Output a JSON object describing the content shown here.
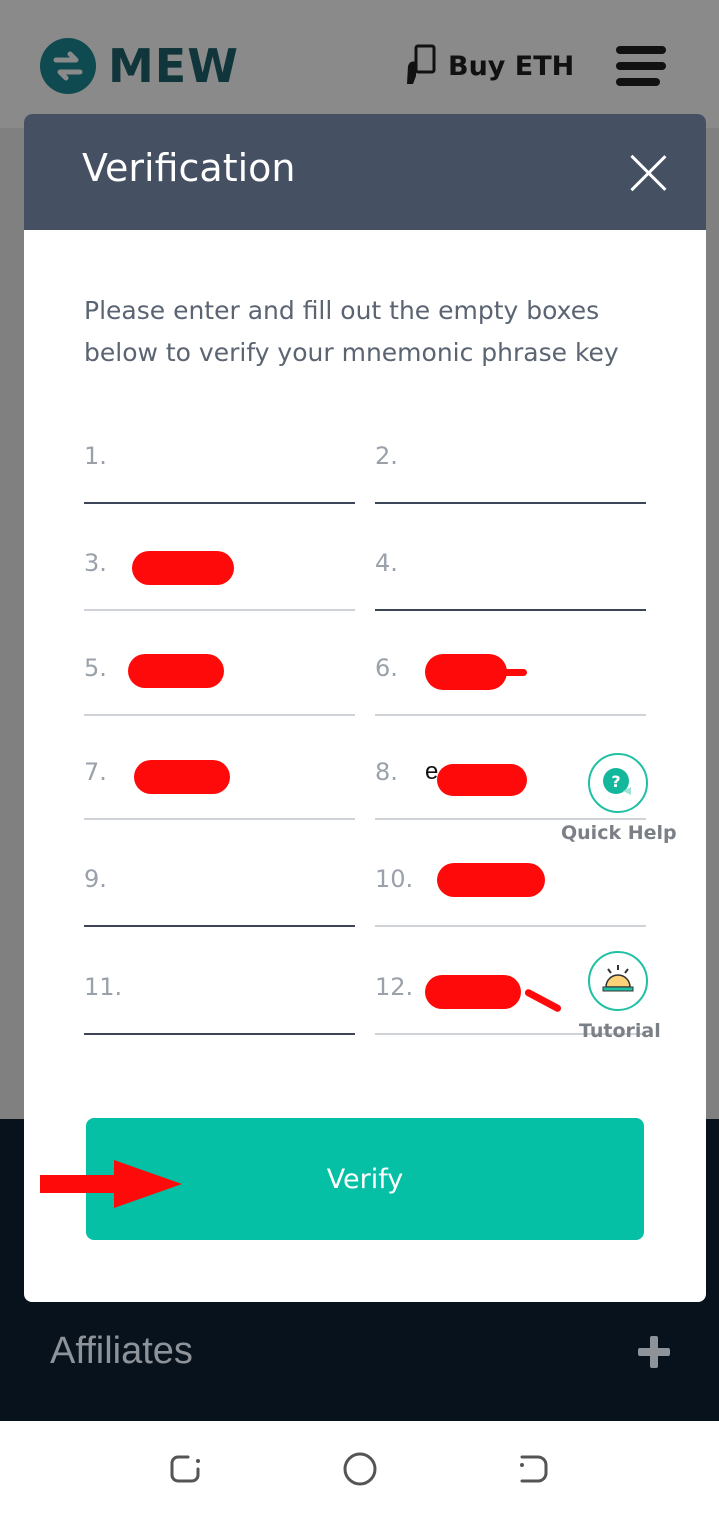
{
  "app": {
    "logo_text": "MEW",
    "buy_label": "Buy ETH"
  },
  "modal": {
    "title": "Verification",
    "instructions": "Please enter and fill out the empty boxes below to verify your mnemonic phrase key",
    "fields": [
      {
        "num": "1.",
        "value": "",
        "redacted": false
      },
      {
        "num": "2.",
        "value": "",
        "redacted": false
      },
      {
        "num": "3.",
        "value": "",
        "redacted": true
      },
      {
        "num": "4.",
        "value": "",
        "redacted": false
      },
      {
        "num": "5.",
        "value": "",
        "redacted": true
      },
      {
        "num": "6.",
        "value": "",
        "redacted": true
      },
      {
        "num": "7.",
        "value": "",
        "redacted": true
      },
      {
        "num": "8.",
        "value": "e",
        "redacted": true
      },
      {
        "num": "9.",
        "value": "",
        "redacted": false
      },
      {
        "num": "10.",
        "value": "",
        "redacted": true
      },
      {
        "num": "11.",
        "value": "",
        "redacted": false
      },
      {
        "num": "12.",
        "value": "",
        "redacted": true
      }
    ],
    "verify_label": "Verify"
  },
  "help": {
    "quick_help_label": "Quick Help",
    "quick_help_icon": "question-icon",
    "tutorial_label": "Tutorial",
    "tutorial_icon": "bell-icon"
  },
  "footer": {
    "affiliates_label": "Affiliates"
  },
  "colors": {
    "header": "#455062",
    "accent": "#05c0a5",
    "redaction": "#ff0a0a"
  }
}
